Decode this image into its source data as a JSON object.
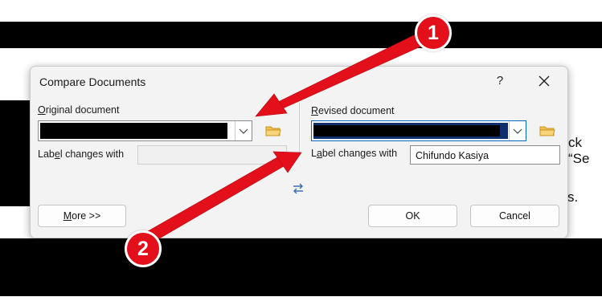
{
  "background": {
    "text_right_1": "ck “Se",
    "text_right_2": "s."
  },
  "dialog": {
    "title": "Compare Documents",
    "help": "?",
    "original": {
      "label_prefix": "O",
      "label_rest": "riginal document",
      "label_changes_prefix": "Lab",
      "label_changes_u": "e",
      "label_changes_rest": "l changes with",
      "label_value": ""
    },
    "revised": {
      "label_prefix": "R",
      "label_rest": "evised document",
      "label_changes_prefix": "L",
      "label_changes_u": "a",
      "label_changes_rest": "bel changes with",
      "label_value": "Chifundo Kasiya"
    },
    "buttons": {
      "more_prefix": "M",
      "more_rest": "ore >>",
      "ok": "OK",
      "cancel": "Cancel"
    }
  },
  "annotations": {
    "badge_1": "1",
    "badge_2": "2",
    "color": "#e3101b"
  }
}
